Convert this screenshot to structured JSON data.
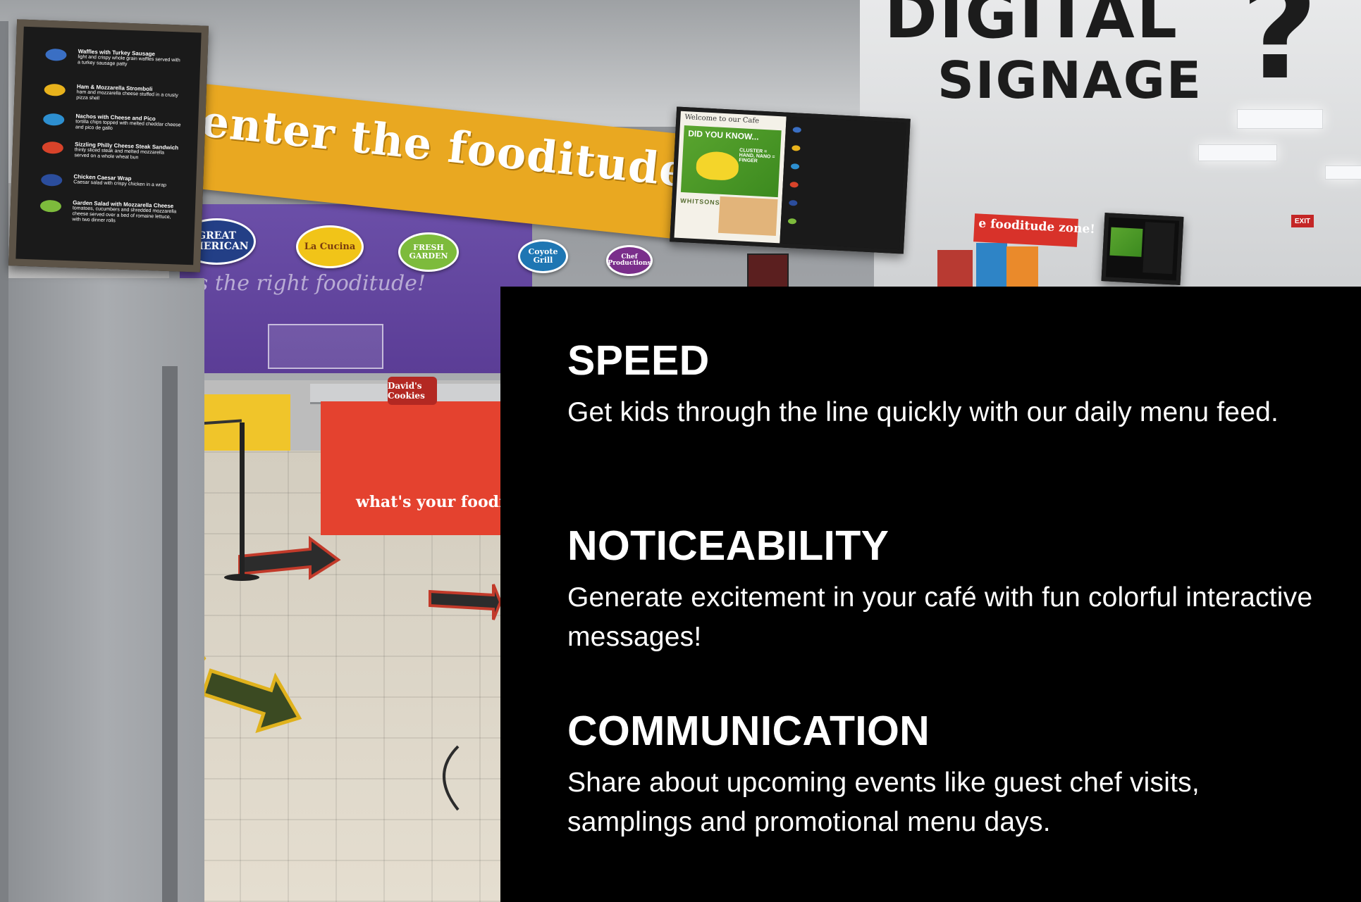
{
  "logo": {
    "line1": "DIGITAL",
    "line2": "SIGNAGE",
    "mark": "?"
  },
  "banner": {
    "main": "enter the fooditude zone!",
    "distant": "e fooditude zone!"
  },
  "wall_script": "as the right fooditude!",
  "counter_text": "what's your foodi",
  "stations": {
    "american": "GREAT AMERICAN",
    "cucina": "La Cucina",
    "fresh": "FRESH GARDEN",
    "coyote": "Coyote Grill",
    "chef": "Chef Productions",
    "cookies": "David's Cookies"
  },
  "menu_board": {
    "items": [
      {
        "title": "Waffles with Turkey Sausage",
        "desc": "light and crispy whole grain waffles served with a turkey sausage patty",
        "color": "#3a6fc4"
      },
      {
        "title": "Ham & Mozzarella Stromboli",
        "desc": "ham and mozzarella cheese stuffed in a crusty pizza shell",
        "color": "#e8b21c"
      },
      {
        "title": "Nachos with Cheese and Pico",
        "desc": "tortilla chips topped with melted cheddar cheese and pico de gallo",
        "color": "#2d8fd0"
      },
      {
        "title": "Sizzling Philly Cheese Steak Sandwich",
        "desc": "thinly sliced steak and melted mozzarella served on a whole wheat bun",
        "color": "#d8432a"
      },
      {
        "title": "Chicken Caesar Wrap",
        "desc": "Caesar salad with crispy chicken in a wrap",
        "color": "#2b4d9c"
      },
      {
        "title": "Garden Salad with Mozzarella Cheese",
        "desc": "tomatoes, cucumbers and shredded mozzarella cheese served over a bed of romaine lettuce, with two dinner rolls",
        "color": "#7dbb3c"
      }
    ]
  },
  "tv_main": {
    "header": "Welcome to our Cafe",
    "did_you_know": "DID YOU KNOW...",
    "banana_facts": "CLUSTER = HAND, NANO = FINGER",
    "sponsor": "WHITSONS"
  },
  "exit_sign": "EXIT",
  "sections": [
    {
      "heading": "SPEED",
      "body": "Get kids through the line quickly with our daily menu feed."
    },
    {
      "heading": "NOTICEABILITY",
      "body": "Generate excitement in your café with fun colorful interactive messages!"
    },
    {
      "heading": "COMMUNICATION",
      "body": "Share about upcoming events like guest chef visits, samplings and promotional menu days."
    }
  ],
  "colors": {
    "panel": "#000000",
    "banner": "#e9a821",
    "text": "#ffffff"
  }
}
